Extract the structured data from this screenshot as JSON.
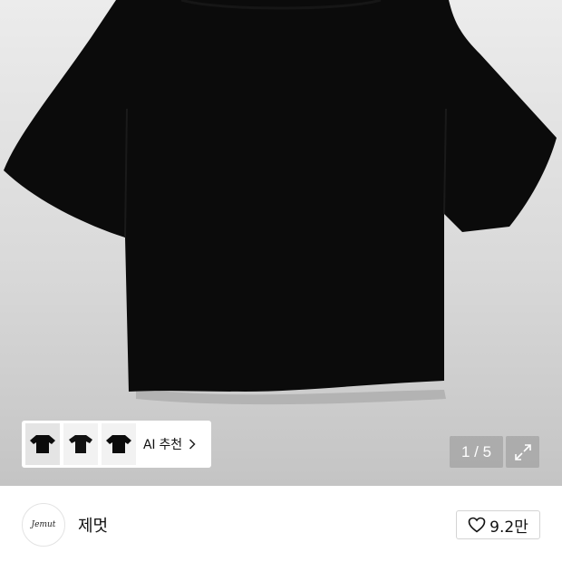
{
  "product": {
    "image": "black-oversized-tshirt",
    "background_color": "#d9d9d9",
    "garment_color": "#0b0b0b"
  },
  "ai_recommend": {
    "label": "AI 추천",
    "thumbnails": [
      "black-tshirt-thumb-1",
      "black-tshirt-thumb-2",
      "black-tshirt-thumb-3"
    ],
    "chevron_icon": "chevron-right-icon"
  },
  "gallery": {
    "counter": "1 / 5",
    "expand_icon": "expand-icon"
  },
  "brand": {
    "logo_text": "Jemut",
    "name": "제멋",
    "like_icon": "heart-outline-icon",
    "like_count": "9.2만"
  }
}
